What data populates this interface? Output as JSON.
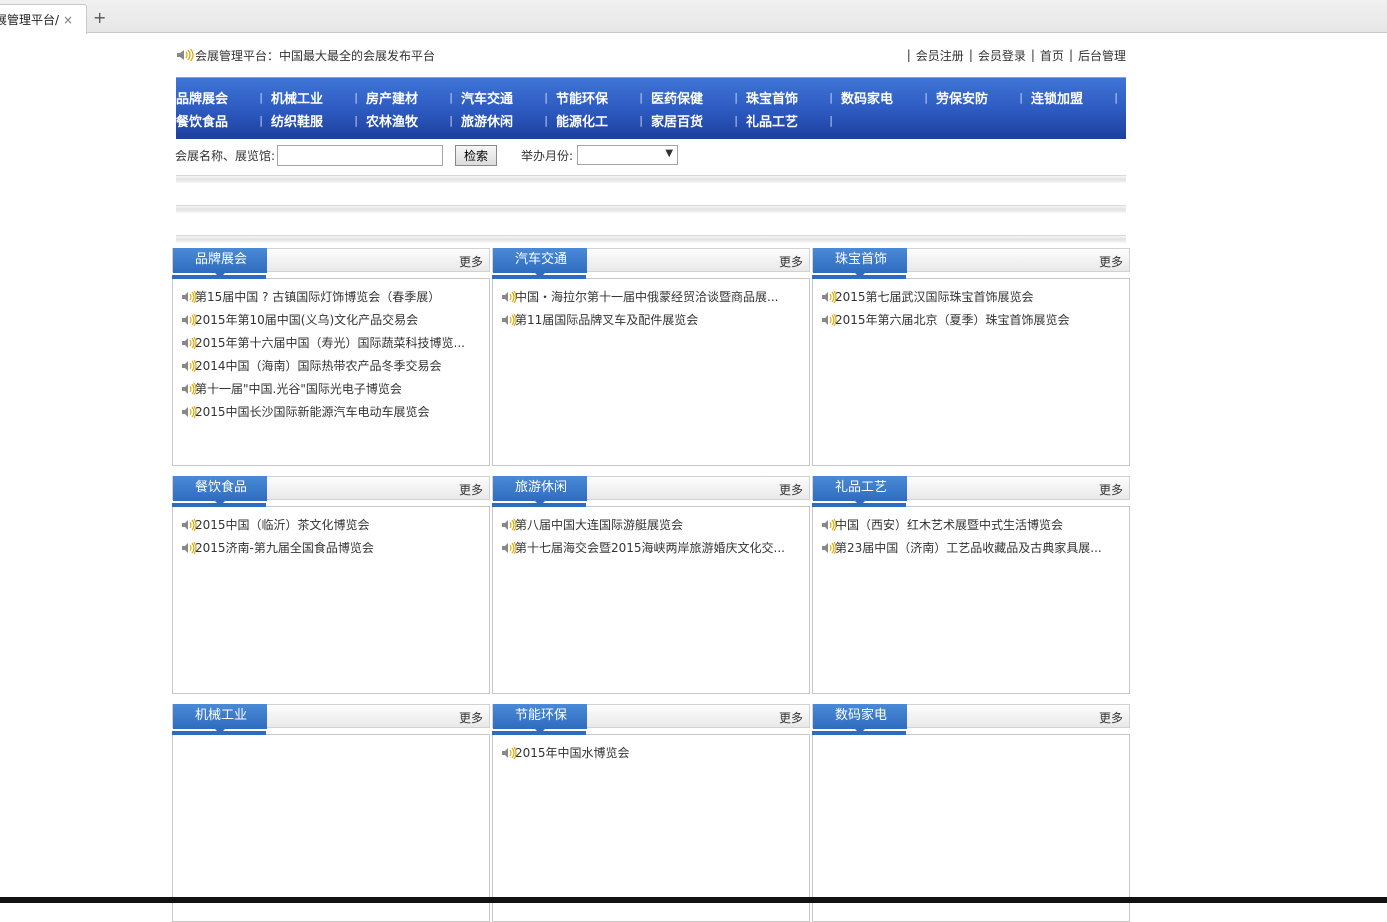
{
  "browser": {
    "tab_title": "展管理平台/",
    "tab_close": "×",
    "new_tab": "+"
  },
  "header": {
    "notice": "会展管理平台：中国最大最全的会展发布平台",
    "links": [
      "会员注册",
      "会员登录",
      "首页",
      "后台管理"
    ]
  },
  "nav": {
    "row1": [
      "品牌展会",
      "机械工业",
      "房产建材",
      "汽车交通",
      "节能环保",
      "医药保健",
      "珠宝首饰",
      "数码家电",
      "劳保安防",
      "连锁加盟"
    ],
    "row2": [
      "餐饮食品",
      "纺织鞋服",
      "农林渔牧",
      "旅游休闲",
      "能源化工",
      "家居百货",
      "礼品工艺"
    ]
  },
  "search": {
    "name_label": "会展名称、展览馆:",
    "name_value": "",
    "button": "检索",
    "month_label": "举办月份:",
    "month_value": "",
    "dropdown_arrow": "▼"
  },
  "panels": [
    {
      "title": "品牌展会",
      "more": "更多",
      "items": [
        "第15届中国 ? 古镇国际灯饰博览会（春季展）",
        "2015年第10届中国(义乌)文化产品交易会",
        "2015年第十六届中国（寿光）国际蔬菜科技博览...",
        "2014中国（海南）国际热带农产品冬季交易会",
        "第十一届\"中国.光谷\"国际光电子博览会",
        "2015中国长沙国际新能源汽车电动车展览会"
      ]
    },
    {
      "title": "汽车交通",
      "more": "更多",
      "items": [
        "中国・海拉尔第十一届中俄蒙经贸洽谈暨商品展...",
        "第11届国际品牌叉车及配件展览会"
      ]
    },
    {
      "title": "珠宝首饰",
      "more": "更多",
      "items": [
        "2015第七届武汉国际珠宝首饰展览会",
        "2015年第六届北京（夏季）珠宝首饰展览会"
      ]
    },
    {
      "title": "餐饮食品",
      "more": "更多",
      "items": [
        "2015中国（临沂）茶文化博览会",
        "2015济南-第九届全国食品博览会"
      ]
    },
    {
      "title": "旅游休闲",
      "more": "更多",
      "items": [
        "第八届中国大连国际游艇展览会",
        "第十七届海交会暨2015海峡两岸旅游婚庆文化交..."
      ]
    },
    {
      "title": "礼品工艺",
      "more": "更多",
      "items": [
        "中国（西安）红木艺术展暨中式生活博览会",
        "第23届中国（济南）工艺品收藏品及古典家具展..."
      ]
    },
    {
      "title": "机械工业",
      "more": "更多",
      "items": []
    },
    {
      "title": "节能环保",
      "more": "更多",
      "items": [
        "2015年中国水博览会"
      ]
    },
    {
      "title": "数码家电",
      "more": "更多",
      "items": []
    }
  ]
}
